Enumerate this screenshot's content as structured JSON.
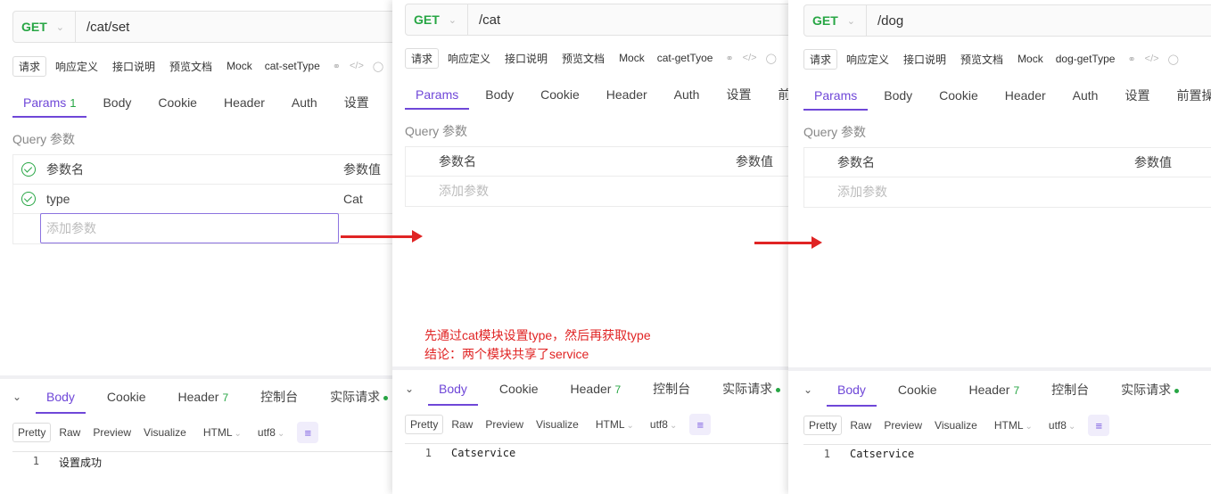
{
  "panels": [
    {
      "method": "GET",
      "url": "/cat/set",
      "request_tabs": [
        "请求",
        "响应定义",
        "接口说明",
        "预览文档",
        "Mock"
      ],
      "api_name": "cat-setType",
      "param_tabs": [
        "Params",
        "Body",
        "Cookie",
        "Header",
        "Auth",
        "设置"
      ],
      "params_count": "1",
      "query_title": "Query 参数",
      "col_name": "参数名",
      "col_value": "参数值",
      "param_row": {
        "name": "type",
        "value": "Cat"
      },
      "add_param": "添加参数",
      "response_tabs": [
        "Body",
        "Cookie",
        "Header",
        "控制台",
        "实际请求"
      ],
      "header_count": "7",
      "formats": [
        "Pretty",
        "Raw",
        "Preview",
        "Visualize"
      ],
      "format_select": "HTML",
      "encoding_select": "utf8",
      "line_no": "1",
      "response_text": "设置成功"
    },
    {
      "method": "GET",
      "url": "/cat",
      "request_tabs": [
        "请求",
        "响应定义",
        "接口说明",
        "预览文档",
        "Mock"
      ],
      "api_name": "cat-getTyoe",
      "param_tabs": [
        "Params",
        "Body",
        "Cookie",
        "Header",
        "Auth",
        "设置",
        "前"
      ],
      "query_title": "Query 参数",
      "col_name": "参数名",
      "col_value": "参数值",
      "add_param": "添加参数",
      "response_tabs": [
        "Body",
        "Cookie",
        "Header",
        "控制台",
        "实际请求"
      ],
      "header_count": "7",
      "formats": [
        "Pretty",
        "Raw",
        "Preview",
        "Visualize"
      ],
      "format_select": "HTML",
      "encoding_select": "utf8",
      "line_no": "1",
      "response_text": "Catservice"
    },
    {
      "method": "GET",
      "url": "/dog",
      "request_tabs": [
        "请求",
        "响应定义",
        "接口说明",
        "预览文档",
        "Mock"
      ],
      "api_name": "dog-getType",
      "param_tabs": [
        "Params",
        "Body",
        "Cookie",
        "Header",
        "Auth",
        "设置",
        "前置操"
      ],
      "query_title": "Query 参数",
      "col_name": "参数名",
      "col_value": "参数值",
      "add_param": "添加参数",
      "response_tabs": [
        "Body",
        "Cookie",
        "Header",
        "控制台",
        "实际请求"
      ],
      "header_count": "7",
      "formats": [
        "Pretty",
        "Raw",
        "Preview",
        "Visualize"
      ],
      "format_select": "HTML",
      "encoding_select": "utf8",
      "line_no": "1",
      "response_text": "Catservice"
    }
  ],
  "annotation": {
    "line1": "先通过cat模块设置type，然后再获取type",
    "line2": "结论：两个模块共享了service"
  },
  "colors": {
    "accent": "#6f47d8",
    "method": "#27a644",
    "annotation": "#e02424"
  },
  "icons": [
    "link-icon",
    "code-icon",
    "copy-icon",
    "check-circle-icon",
    "collapse-chevron-icon",
    "wrap-lines-icon",
    "arrow-right-icon"
  ]
}
